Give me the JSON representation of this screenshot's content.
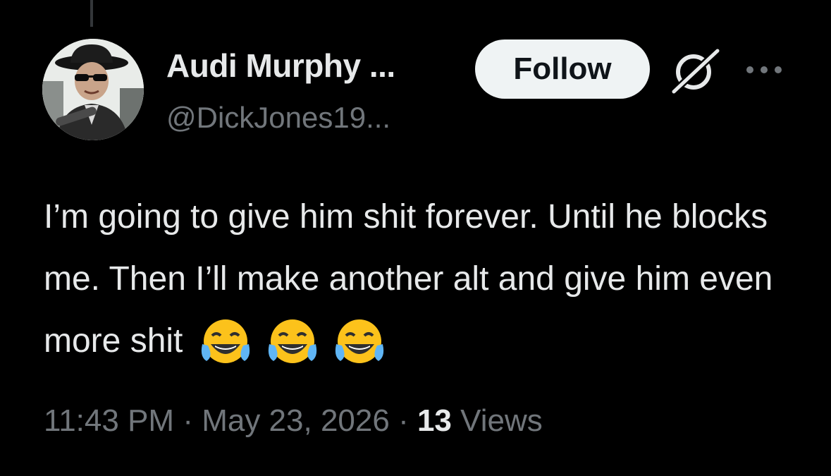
{
  "author": {
    "display_name": "Audi Murphy ...",
    "handle": "@DickJones19..."
  },
  "actions": {
    "follow_label": "Follow",
    "grok_icon": "grok-slash-icon",
    "more_icon": "more-horizontal-icon"
  },
  "tweet": {
    "text": "I’m going to give him shit forever. Until he blocks me. Then I’ll make another alt and give him even more shit",
    "emojis": [
      "face-with-tears-of-joy",
      "face-with-tears-of-joy",
      "face-with-tears-of-joy"
    ]
  },
  "meta": {
    "time": "11:43 PM",
    "separator": "·",
    "date": "May 23, 2026",
    "views_count": "13",
    "views_label": "Views"
  },
  "colors": {
    "background": "#000000",
    "primary_text": "#e7e9ea",
    "secondary_text": "#71767b",
    "follow_bg": "#eff3f4",
    "follow_text": "#0f1419"
  }
}
